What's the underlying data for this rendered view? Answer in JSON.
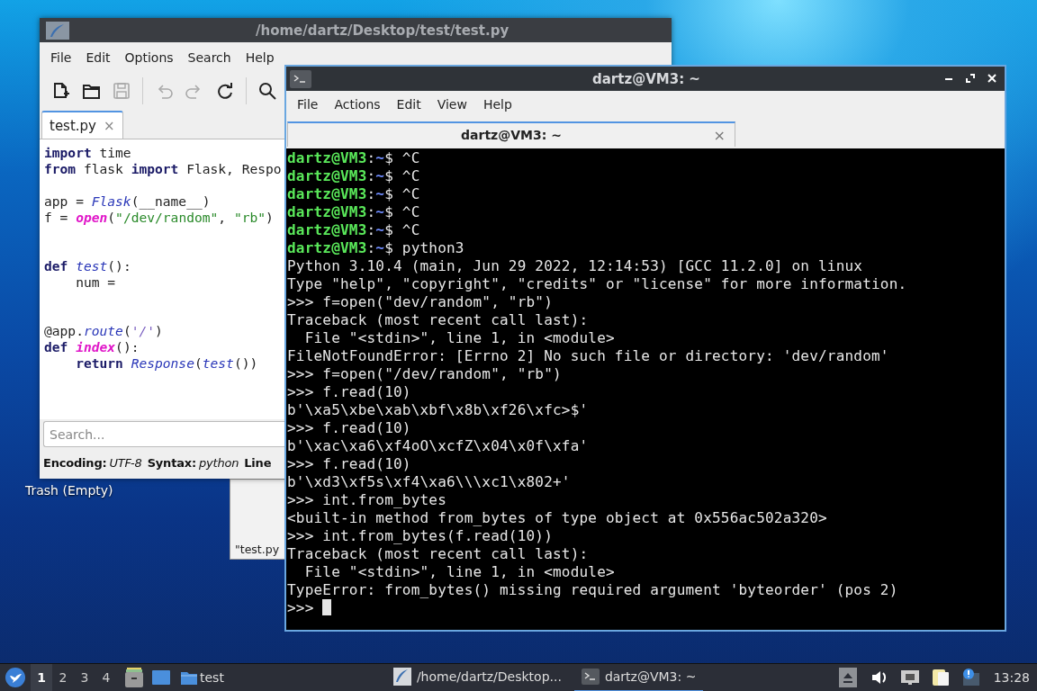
{
  "desktop": {
    "icons": [
      {
        "label": "Trash (Empty)"
      }
    ],
    "background_window": {
      "title": "\"test.py"
    }
  },
  "editor": {
    "title": "/home/dartz/Desktop/test/test.py",
    "menu": [
      "File",
      "Edit",
      "Options",
      "Search",
      "Help"
    ],
    "toolbar": [
      {
        "kind": "new",
        "disabled": false
      },
      {
        "kind": "open",
        "disabled": false
      },
      {
        "kind": "save",
        "disabled": true
      },
      {
        "kind": "undo",
        "disabled": true
      },
      {
        "kind": "redo",
        "disabled": true
      },
      {
        "kind": "reload",
        "disabled": false
      },
      {
        "kind": "search",
        "disabled": false
      }
    ],
    "tabs": [
      {
        "label": "test.py",
        "close": "×",
        "selected": true
      }
    ],
    "code": [
      {
        "kind": "code",
        "parts": [
          {
            "kind": "keyword",
            "text": "import"
          },
          {
            "kind": "plain",
            "text": " time"
          }
        ]
      },
      {
        "kind": "code",
        "parts": [
          {
            "kind": "keyword",
            "text": "from"
          },
          {
            "kind": "plain",
            "text": " flask "
          },
          {
            "kind": "keyword",
            "text": "import"
          },
          {
            "kind": "plain",
            "text": " Flask, Respo"
          }
        ]
      },
      {
        "kind": "blank"
      },
      {
        "kind": "code",
        "parts": [
          {
            "kind": "plain",
            "text": "app = "
          },
          {
            "kind": "function",
            "text": "Flask"
          },
          {
            "kind": "plain",
            "text": "(__name__)"
          }
        ]
      },
      {
        "kind": "code",
        "parts": [
          {
            "kind": "plain",
            "text": "f = "
          },
          {
            "kind": "builtin",
            "text": "open"
          },
          {
            "kind": "plain",
            "text": "("
          },
          {
            "kind": "string",
            "text": "\"/dev/random\""
          },
          {
            "kind": "plain",
            "text": ", "
          },
          {
            "kind": "string",
            "text": "\"rb\""
          },
          {
            "kind": "plain",
            "text": ")"
          }
        ]
      },
      {
        "kind": "blank"
      },
      {
        "kind": "blank"
      },
      {
        "kind": "code",
        "parts": [
          {
            "kind": "keyword",
            "text": "def "
          },
          {
            "kind": "function",
            "text": "test"
          },
          {
            "kind": "plain",
            "text": "():"
          }
        ]
      },
      {
        "kind": "code",
        "parts": [
          {
            "kind": "plain",
            "text": "    num ="
          }
        ]
      },
      {
        "kind": "blank"
      },
      {
        "kind": "blank"
      },
      {
        "kind": "code",
        "parts": [
          {
            "kind": "plain",
            "text": "@app."
          },
          {
            "kind": "function",
            "text": "route"
          },
          {
            "kind": "plain",
            "text": "("
          },
          {
            "kind": "quote",
            "text": "'/'"
          },
          {
            "kind": "plain",
            "text": ")"
          }
        ]
      },
      {
        "kind": "code",
        "parts": [
          {
            "kind": "keyword",
            "text": "def "
          },
          {
            "kind": "builtin",
            "text": "index"
          },
          {
            "kind": "plain",
            "text": "():"
          }
        ]
      },
      {
        "kind": "code",
        "parts": [
          {
            "kind": "keyword",
            "text": "    return "
          },
          {
            "kind": "function",
            "text": "Response"
          },
          {
            "kind": "plain",
            "text": "("
          },
          {
            "kind": "function",
            "text": "test"
          },
          {
            "kind": "plain",
            "text": "())"
          }
        ]
      }
    ],
    "search": {
      "placeholder": "Search..."
    },
    "status": [
      {
        "label": "Encoding:",
        "value": "UTF-8"
      },
      {
        "label": "Syntax:",
        "value": "python"
      },
      {
        "label": "Line"
      }
    ]
  },
  "terminal": {
    "title": "dartz@VM3: ~",
    "menu": [
      "File",
      "Actions",
      "Edit",
      "View",
      "Help"
    ],
    "tabs": [
      {
        "label": "dartz@VM3: ~",
        "close": "×",
        "selected": true
      }
    ],
    "lines": [
      {
        "kind": "prompt",
        "user": "dartz@VM3",
        "sep": ":",
        "path": "~",
        "rest": "$ ^C"
      },
      {
        "kind": "prompt",
        "user": "dartz@VM3",
        "sep": ":",
        "path": "~",
        "rest": "$ ^C"
      },
      {
        "kind": "prompt",
        "user": "dartz@VM3",
        "sep": ":",
        "path": "~",
        "rest": "$ ^C"
      },
      {
        "kind": "prompt",
        "user": "dartz@VM3",
        "sep": ":",
        "path": "~",
        "rest": "$ ^C"
      },
      {
        "kind": "prompt",
        "user": "dartz@VM3",
        "sep": ":",
        "path": "~",
        "rest": "$ ^C"
      },
      {
        "kind": "prompt",
        "user": "dartz@VM3",
        "sep": ":",
        "path": "~",
        "rest": "$ python3"
      },
      {
        "kind": "output",
        "text": "Python 3.10.4 (main, Jun 29 2022, 12:14:53) [GCC 11.2.0] on linux"
      },
      {
        "kind": "output",
        "text": "Type \"help\", \"copyright\", \"credits\" or \"license\" for more information."
      },
      {
        "kind": "output",
        "text": ">>> f=open(\"dev/random\", \"rb\")"
      },
      {
        "kind": "output",
        "text": "Traceback (most recent call last):"
      },
      {
        "kind": "output",
        "text": "  File \"<stdin>\", line 1, in <module>"
      },
      {
        "kind": "output",
        "text": "FileNotFoundError: [Errno 2] No such file or directory: 'dev/random'"
      },
      {
        "kind": "output",
        "text": ">>> f=open(\"/dev/random\", \"rb\")"
      },
      {
        "kind": "output",
        "text": ">>> f.read(10)"
      },
      {
        "kind": "output",
        "text": "b'\\xa5\\xbe\\xab\\xbf\\x8b\\xf26\\xfc>$'"
      },
      {
        "kind": "output",
        "text": ">>> f.read(10)"
      },
      {
        "kind": "output",
        "text": "b'\\xac\\xa6\\xf4oO\\xcfZ\\x04\\x0f\\xfa'"
      },
      {
        "kind": "output",
        "text": ">>> f.read(10)"
      },
      {
        "kind": "output",
        "text": "b'\\xd3\\xf5s\\xf4\\xa6\\\\\\xc1\\x802+'"
      },
      {
        "kind": "output",
        "text": ">>> int.from_bytes"
      },
      {
        "kind": "output",
        "text": "<built-in method from_bytes of type object at 0x556ac502a320>"
      },
      {
        "kind": "output",
        "text": ">>> int.from_bytes(f.read(10))"
      },
      {
        "kind": "output",
        "text": "Traceback (most recent call last):"
      },
      {
        "kind": "output",
        "text": "  File \"<stdin>\", line 1, in <module>"
      },
      {
        "kind": "output",
        "text": "TypeError: from_bytes() missing required argument 'byteorder' (pos 2)"
      },
      {
        "kind": "input",
        "text": ">>>",
        "cursor": true
      }
    ]
  },
  "taskbar": {
    "workspaces": [
      {
        "label": "1",
        "selected": true
      },
      {
        "label": "2",
        "selected": false
      },
      {
        "label": "3",
        "selected": false
      },
      {
        "label": "4",
        "selected": false
      }
    ],
    "launchers": [
      {
        "kind": "files"
      },
      {
        "kind": "desktop"
      },
      {
        "kind": "folder",
        "label": "test"
      }
    ],
    "tasks": [
      {
        "kind": "editor",
        "label": "/home/dartz/Desktop...",
        "selected": false
      },
      {
        "kind": "terminal",
        "label": "dartz@VM3: ~",
        "selected": true
      }
    ],
    "tray": [
      {
        "kind": "eject"
      },
      {
        "kind": "volume"
      },
      {
        "kind": "network"
      },
      {
        "kind": "clipboard"
      },
      {
        "kind": "notice"
      }
    ],
    "clock": "13:28"
  }
}
